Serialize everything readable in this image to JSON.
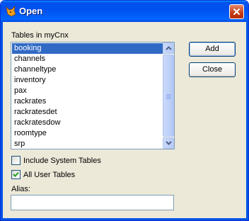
{
  "window": {
    "title": "Open"
  },
  "tables_label": "Tables in myCnx",
  "tables": [
    "booking",
    "channels",
    "channeltype",
    "inventory",
    "pax",
    "rackrates",
    "rackratesdet",
    "rackratesdow",
    "roomtype",
    "srp"
  ],
  "selected_table": "booking",
  "buttons": {
    "add": "Add",
    "close": "Close"
  },
  "include_system_tables": {
    "label": "Include System Tables",
    "checked": false
  },
  "all_user_tables": {
    "label": "All User Tables",
    "checked": true
  },
  "alias": {
    "label": "Alias:",
    "value": ""
  },
  "colors": {
    "selection": "#316ac5",
    "titlebar": "#0053ee",
    "dialog_bg": "#ece9d8"
  }
}
